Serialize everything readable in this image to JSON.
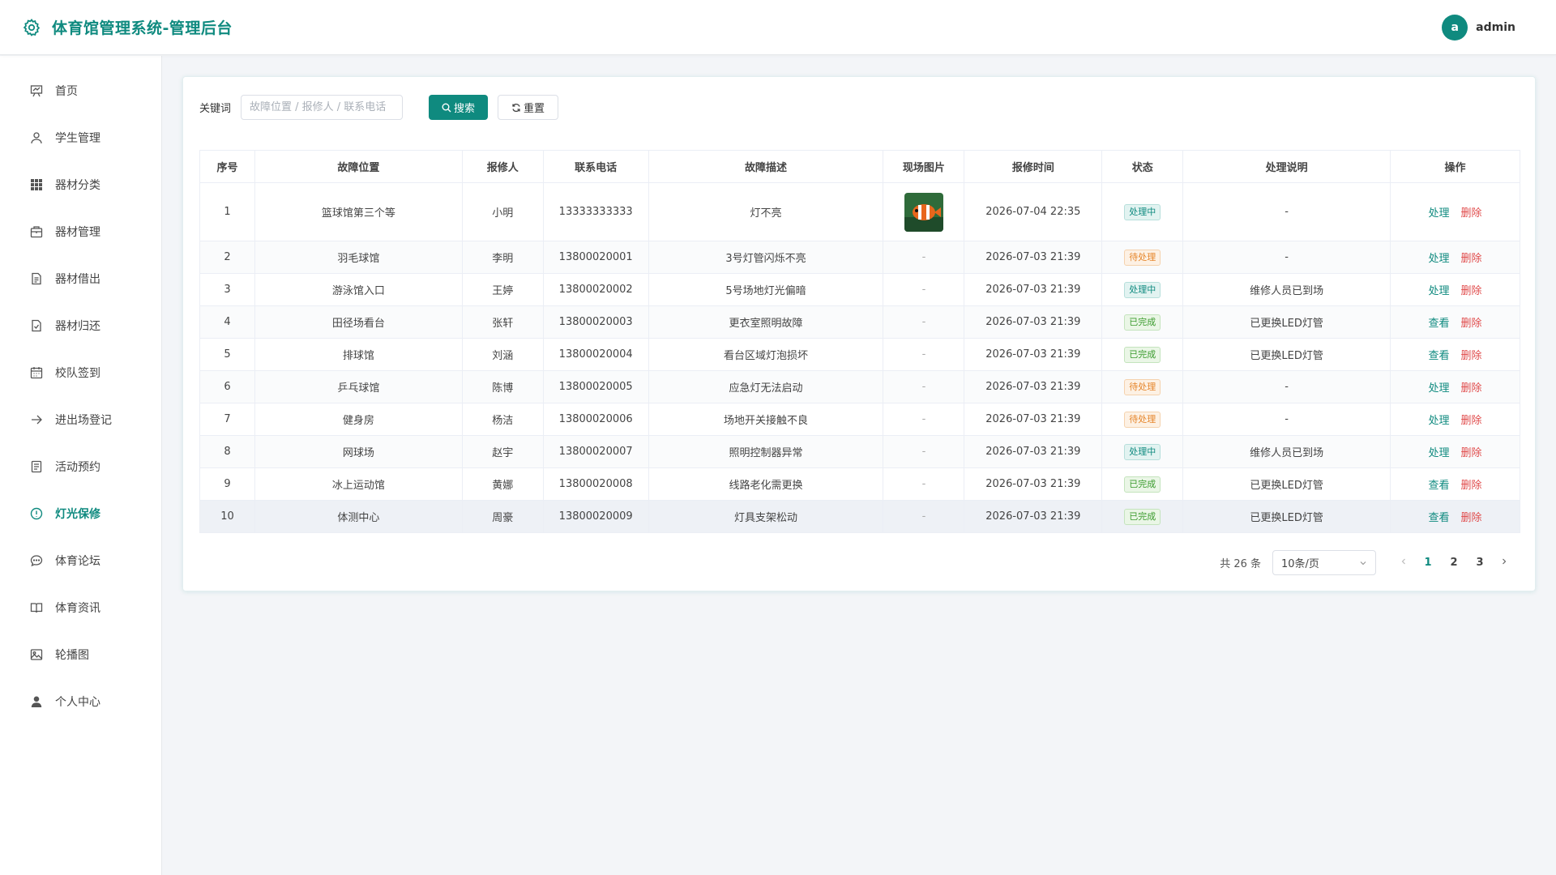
{
  "app": {
    "title": "体育馆管理系统-管理后台",
    "user_initial": "a",
    "username": "admin",
    "accent": "#0f8a7f"
  },
  "sidebar": {
    "items": [
      {
        "label": "首页",
        "icon": "presentation-icon"
      },
      {
        "label": "学生管理",
        "icon": "user-icon"
      },
      {
        "label": "器材分类",
        "icon": "grid-icon"
      },
      {
        "label": "器材管理",
        "icon": "box-icon"
      },
      {
        "label": "器材借出",
        "icon": "document-icon"
      },
      {
        "label": "器材归还",
        "icon": "document-check-icon"
      },
      {
        "label": "校队签到",
        "icon": "calendar-icon"
      },
      {
        "label": "进出场登记",
        "icon": "arrow-right-icon"
      },
      {
        "label": "活动预约",
        "icon": "list-document-icon"
      },
      {
        "label": "灯光保修",
        "icon": "warning-circle-icon",
        "active": true
      },
      {
        "label": "体育论坛",
        "icon": "chat-icon"
      },
      {
        "label": "体育资讯",
        "icon": "book-icon"
      },
      {
        "label": "轮播图",
        "icon": "image-icon"
      },
      {
        "label": "个人中心",
        "icon": "user-filled-icon"
      }
    ]
  },
  "search": {
    "label": "关键词",
    "placeholder": "故障位置 / 报修人 / 联系电话",
    "search_label": "搜索",
    "reset_label": "重置"
  },
  "table": {
    "headers": [
      "序号",
      "故障位置",
      "报修人",
      "联系电话",
      "故障描述",
      "现场图片",
      "报修时间",
      "状态",
      "处理说明",
      "操作"
    ],
    "rows": [
      {
        "no": "1",
        "location": "篮球馆第三个等",
        "reporter": "小明",
        "phone": "13333333333",
        "desc": "灯不亮",
        "photo": "clownfish",
        "time": "2026-07-04 22:35",
        "status": "处理中",
        "status_type": "processing",
        "note": "-",
        "action": "处理",
        "delete": "删除"
      },
      {
        "no": "2",
        "location": "羽毛球馆",
        "reporter": "李明",
        "phone": "13800020001",
        "desc": "3号灯管闪烁不亮",
        "photo": "-",
        "time": "2026-07-03 21:39",
        "status": "待处理",
        "status_type": "pending",
        "note": "-",
        "action": "处理",
        "delete": "删除"
      },
      {
        "no": "3",
        "location": "游泳馆入口",
        "reporter": "王婷",
        "phone": "13800020002",
        "desc": "5号场地灯光偏暗",
        "photo": "-",
        "time": "2026-07-03 21:39",
        "status": "处理中",
        "status_type": "processing",
        "note": "维修人员已到场",
        "action": "处理",
        "delete": "删除"
      },
      {
        "no": "4",
        "location": "田径场看台",
        "reporter": "张轩",
        "phone": "13800020003",
        "desc": "更衣室照明故障",
        "photo": "-",
        "time": "2026-07-03 21:39",
        "status": "已完成",
        "status_type": "done",
        "note": "已更换LED灯管",
        "action": "查看",
        "delete": "删除"
      },
      {
        "no": "5",
        "location": "排球馆",
        "reporter": "刘涵",
        "phone": "13800020004",
        "desc": "看台区域灯泡损坏",
        "photo": "-",
        "time": "2026-07-03 21:39",
        "status": "已完成",
        "status_type": "done",
        "note": "已更换LED灯管",
        "action": "查看",
        "delete": "删除"
      },
      {
        "no": "6",
        "location": "乒乓球馆",
        "reporter": "陈博",
        "phone": "13800020005",
        "desc": "应急灯无法启动",
        "photo": "-",
        "time": "2026-07-03 21:39",
        "status": "待处理",
        "status_type": "pending",
        "note": "-",
        "action": "处理",
        "delete": "删除"
      },
      {
        "no": "7",
        "location": "健身房",
        "reporter": "杨洁",
        "phone": "13800020006",
        "desc": "场地开关接触不良",
        "photo": "-",
        "time": "2026-07-03 21:39",
        "status": "待处理",
        "status_type": "pending",
        "note": "-",
        "action": "处理",
        "delete": "删除"
      },
      {
        "no": "8",
        "location": "网球场",
        "reporter": "赵宇",
        "phone": "13800020007",
        "desc": "照明控制器异常",
        "photo": "-",
        "time": "2026-07-03 21:39",
        "status": "处理中",
        "status_type": "processing",
        "note": "维修人员已到场",
        "action": "处理",
        "delete": "删除"
      },
      {
        "no": "9",
        "location": "冰上运动馆",
        "reporter": "黄娜",
        "phone": "13800020008",
        "desc": "线路老化需更换",
        "photo": "-",
        "time": "2026-07-03 21:39",
        "status": "已完成",
        "status_type": "done",
        "note": "已更换LED灯管",
        "action": "查看",
        "delete": "删除"
      },
      {
        "no": "10",
        "location": "体测中心",
        "reporter": "周豪",
        "phone": "13800020009",
        "desc": "灯具支架松动",
        "photo": "-",
        "time": "2026-07-03 21:39",
        "status": "已完成",
        "status_type": "done",
        "note": "已更换LED灯管",
        "action": "查看",
        "delete": "删除"
      }
    ]
  },
  "pagination": {
    "total_text": "共 26 条",
    "page_size": "10条/页",
    "pages": [
      "1",
      "2",
      "3"
    ],
    "current": "1"
  }
}
